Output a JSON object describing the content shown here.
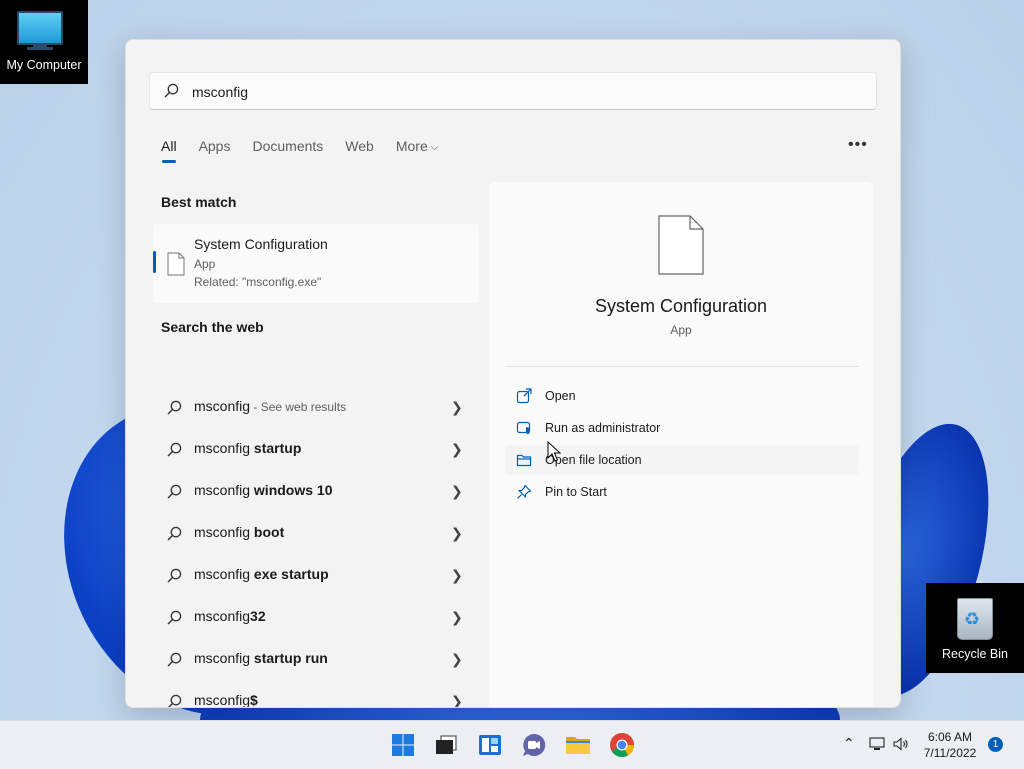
{
  "desktop": {
    "my_computer_label": "My Computer",
    "recycle_bin_label": "Recycle Bin"
  },
  "search": {
    "query": "msconfig",
    "tabs": [
      {
        "label": "All",
        "active": true
      },
      {
        "label": "Apps"
      },
      {
        "label": "Documents"
      },
      {
        "label": "Web"
      },
      {
        "label": "More"
      }
    ],
    "more_options_icon": "ellipsis-icon"
  },
  "best_match": {
    "heading": "Best match",
    "title": "System Configuration",
    "type": "App",
    "related": "Related: \"msconfig.exe\""
  },
  "web": {
    "heading": "Search the web",
    "items": [
      {
        "prefix": "msconfig",
        "bold": "",
        "suffix": " - See web results"
      },
      {
        "prefix": "msconfig ",
        "bold": "startup",
        "suffix": ""
      },
      {
        "prefix": "msconfig ",
        "bold": "windows 10",
        "suffix": ""
      },
      {
        "prefix": "msconfig ",
        "bold": "boot",
        "suffix": ""
      },
      {
        "prefix": "msconfig ",
        "bold": "exe startup",
        "suffix": ""
      },
      {
        "prefix": "msconfig",
        "bold": "32",
        "suffix": ""
      },
      {
        "prefix": "msconfig ",
        "bold": "startup run",
        "suffix": ""
      },
      {
        "prefix": "msconfig",
        "bold": "$",
        "suffix": ""
      }
    ]
  },
  "detail": {
    "title": "System Configuration",
    "type": "App",
    "actions": [
      {
        "label": "Open",
        "icon": "open-external-icon"
      },
      {
        "label": "Run as administrator",
        "icon": "shield-admin-icon"
      },
      {
        "label": "Open file location",
        "icon": "folder-icon"
      },
      {
        "label": "Pin to Start",
        "icon": "pin-icon"
      }
    ]
  },
  "taskbar": {
    "apps": [
      "start-icon",
      "task-view-icon",
      "widgets-icon",
      "teams-chat-icon",
      "file-explorer-icon",
      "chrome-icon"
    ],
    "time": "6:06 AM",
    "date": "7/11/2022",
    "notification_count": "1"
  },
  "colors": {
    "accent": "#005fb8",
    "panel_bg": "#f3f3f3"
  }
}
